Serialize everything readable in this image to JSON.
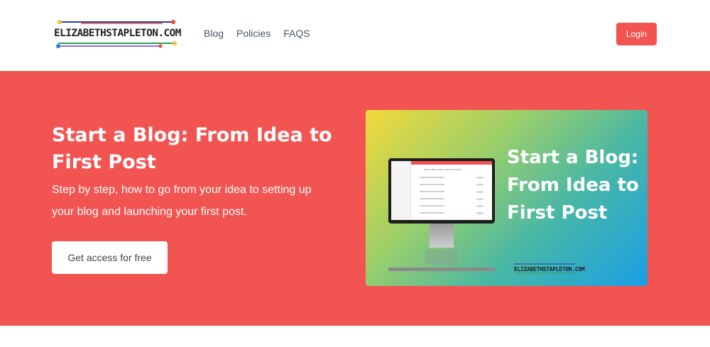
{
  "colors": {
    "accent": "#f25452",
    "nav_text": "#4a5568"
  },
  "header": {
    "logo_text": "ELIZABETHSTAPLETON.COM",
    "nav": [
      "Blog",
      "Policies",
      "FAQS"
    ],
    "login_label": "Login"
  },
  "hero": {
    "title": "Start a Blog: From Idea to First Post",
    "subtitle": "Step by step, how to go from your idea to setting up your blog and launching your first post.",
    "cta_label": "Get access for free",
    "card": {
      "title": "Start a Blog: From Idea to First Post",
      "logo_text": "ELIZABETHSTAPLETON.COM",
      "screen_heading": "Start a Blog: From Idea to First Post"
    }
  }
}
